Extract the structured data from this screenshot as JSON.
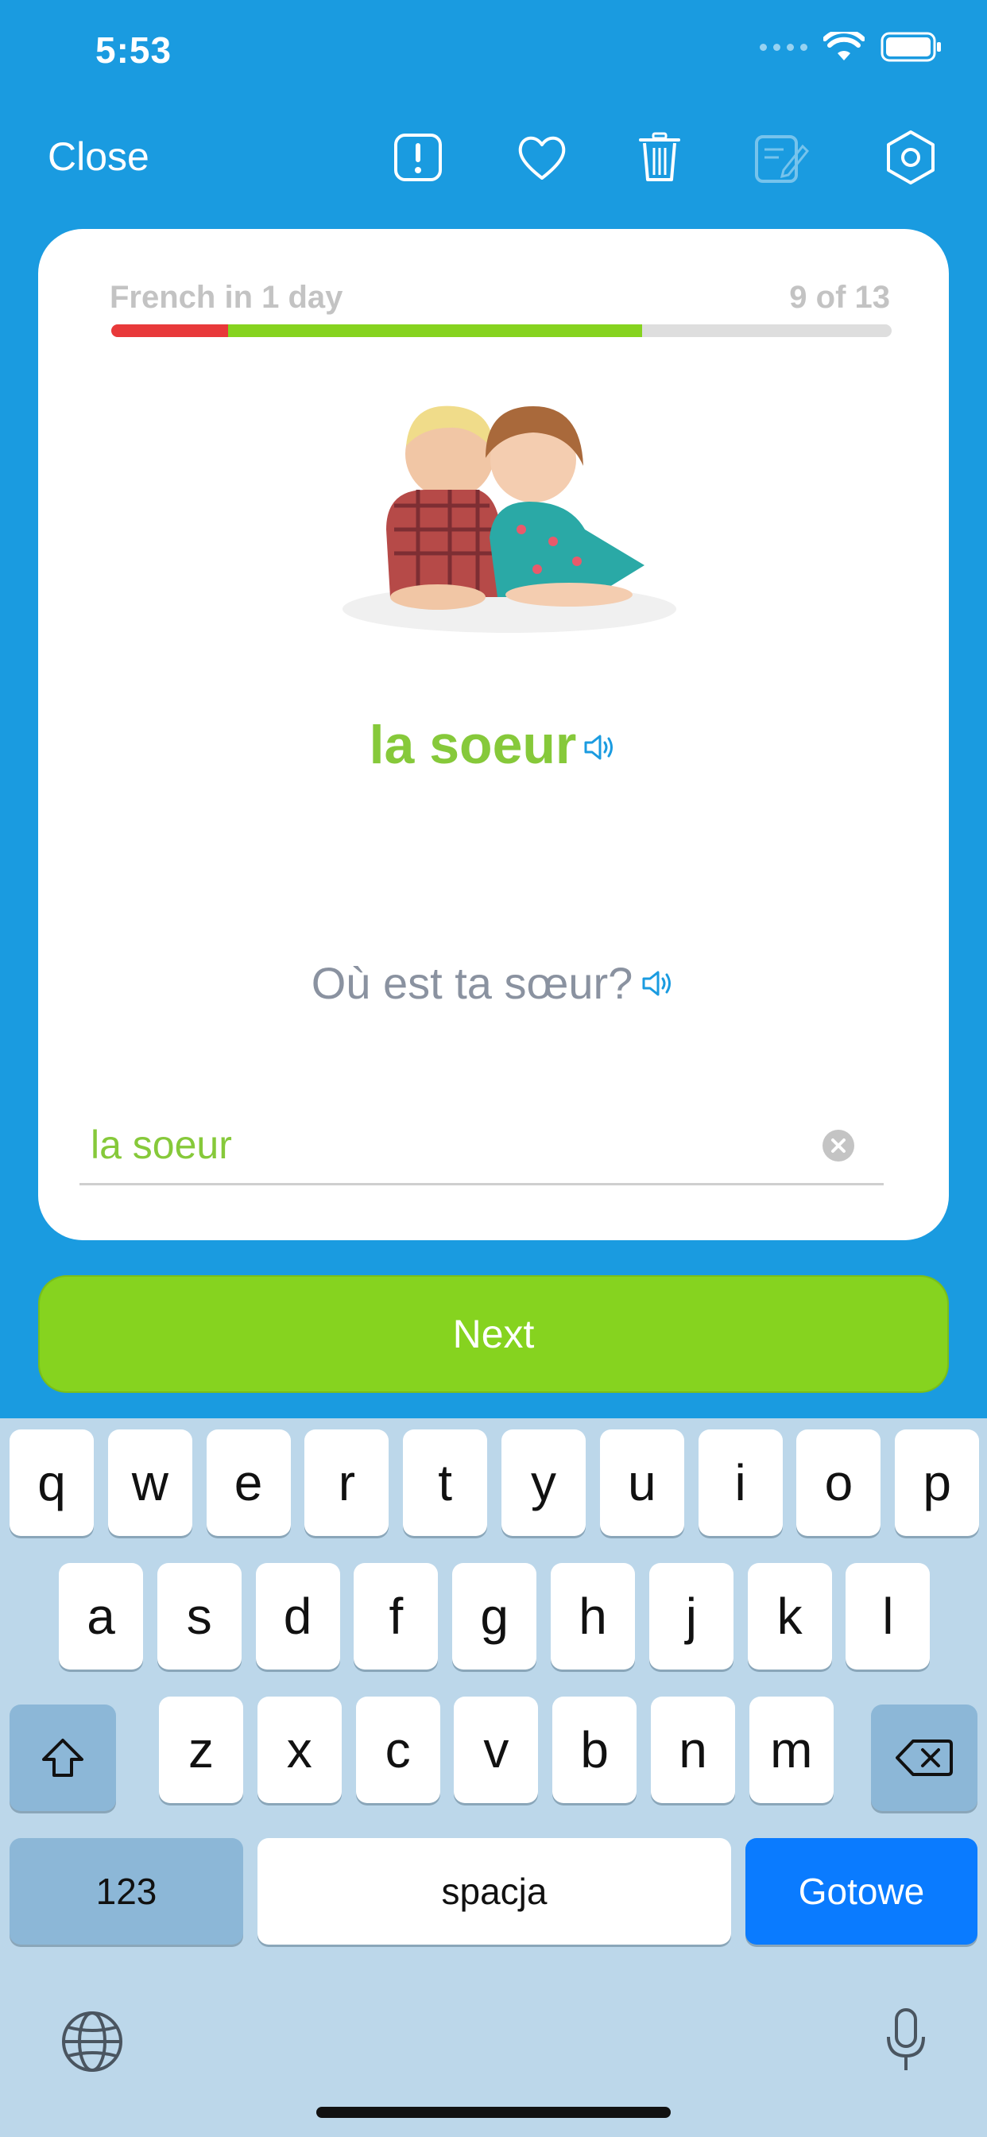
{
  "status": {
    "time": "5:53"
  },
  "toolbar": {
    "close_label": "Close"
  },
  "card": {
    "deck_title": "French in 1 day",
    "deck_count": "9 of 13",
    "progress": {
      "wrong_fraction": 0.15,
      "correct_fraction": 0.53
    },
    "word": "la soeur",
    "sentence": "Où est ta sœur?",
    "answer": {
      "value": "la soeur",
      "placeholder": ""
    }
  },
  "next_label": "Next",
  "keyboard": {
    "row1": [
      "q",
      "w",
      "e",
      "r",
      "t",
      "y",
      "u",
      "i",
      "o",
      "p"
    ],
    "row2": [
      "a",
      "s",
      "d",
      "f",
      "g",
      "h",
      "j",
      "k",
      "l"
    ],
    "row3": [
      "z",
      "x",
      "c",
      "v",
      "b",
      "n",
      "m"
    ],
    "numbers_label": "123",
    "space_label": "spacja",
    "done_label": "Gotowe"
  },
  "colors": {
    "background": "#1a9be0",
    "accent_green": "#86d31f",
    "wrong_red": "#e8393a",
    "keyboard_blue": "#0a7bff"
  },
  "icons": [
    "report-icon",
    "heart-icon",
    "trash-icon",
    "edit-icon",
    "settings-icon",
    "speaker-icon",
    "clear-icon",
    "shift-icon",
    "backspace-icon",
    "globe-icon",
    "microphone-icon"
  ]
}
